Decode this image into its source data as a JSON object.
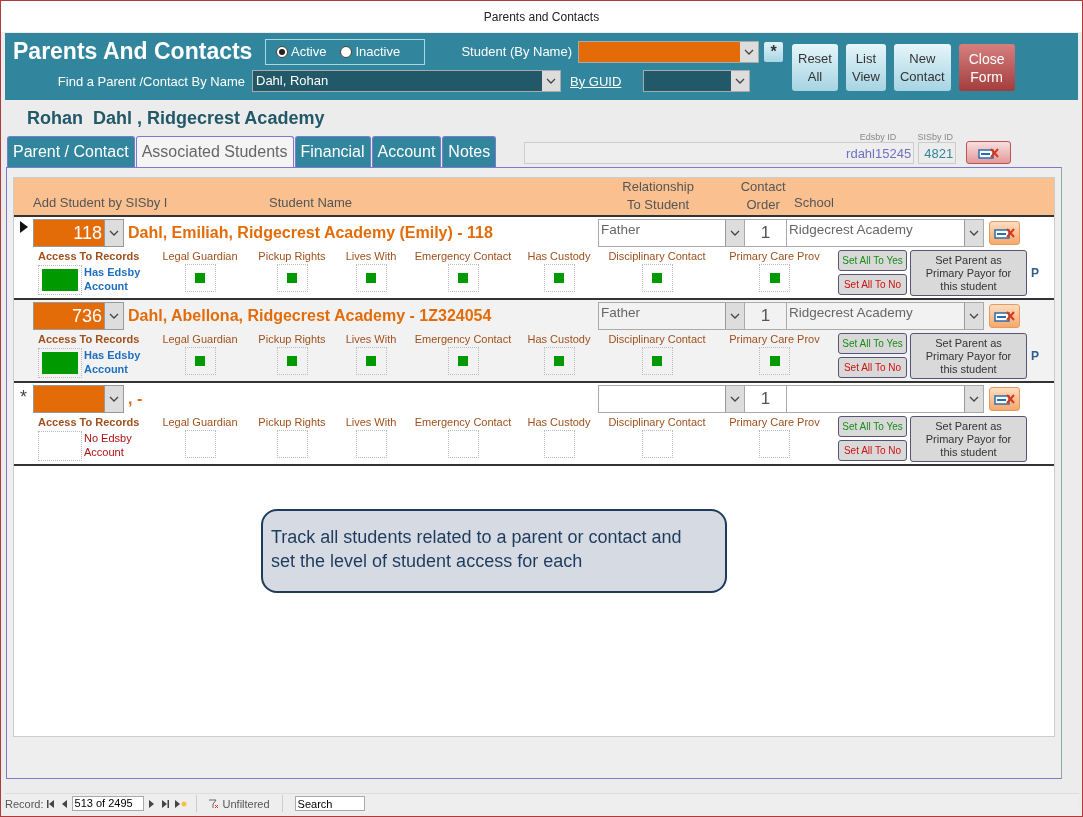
{
  "window": {
    "title": "Parents and Contacts"
  },
  "header": {
    "title": "Parents And Contacts",
    "status_options": [
      {
        "label": "Active",
        "selected": true
      },
      {
        "label": "Inactive",
        "selected": false
      }
    ],
    "student_label": "Student (By Name)",
    "clear_button": "*",
    "find_label": "Find a Parent /Contact By Name",
    "find_value": "Dahl, Rohan",
    "guid_link": "By GUID",
    "buttons": [
      {
        "label": "Reset All",
        "kind": "normal"
      },
      {
        "label": "List View",
        "kind": "normal"
      },
      {
        "label": "New Contact",
        "kind": "normal"
      },
      {
        "label": "Close Form",
        "kind": "danger"
      }
    ]
  },
  "contact_name": "Rohan  Dahl , Ridgecrest Academy",
  "tabs": [
    {
      "label": "Parent / Contact",
      "selected": false
    },
    {
      "label": "Associated Students",
      "selected": true
    },
    {
      "label": "Financial",
      "selected": false
    },
    {
      "label": "Account",
      "selected": false
    },
    {
      "label": "Notes",
      "selected": false
    }
  ],
  "ids": {
    "edsby_label": "Edsby ID",
    "edsby_value": "rdahl15245",
    "sisby_label": "SISby ID",
    "sisby_value": "4821"
  },
  "columns": {
    "add_student": "Add Student by SISby I",
    "student_name": "Student Name",
    "relationship": "Relationship To Student",
    "contact_order": "Contact Order",
    "school": "School"
  },
  "records": [
    {
      "kind": "current",
      "sisby_id": "118",
      "name": "Dahl, Emiliah, Ridgecrest Academy (Emily)  - 118",
      "relationship": "Father",
      "contact_order": "1",
      "school": "Ridgecrest Academy",
      "access_label": "Access To Records",
      "has_account": true,
      "account_text": "Has Edsby Account",
      "flags": [
        {
          "label": "Legal Guardian",
          "checked": true
        },
        {
          "label": "Pickup Rights",
          "checked": true
        },
        {
          "label": "Lives With",
          "checked": true
        },
        {
          "label": "Emergency Contact",
          "checked": true
        },
        {
          "label": "Has Custody",
          "checked": true
        },
        {
          "label": "Disciplinary Contact",
          "checked": true
        },
        {
          "label": "Primary Care Prov",
          "checked": true
        }
      ],
      "set_yes": "Set All To Yes",
      "set_no": "Set All To No",
      "payor_button": "Set Parent as Primary Payor for this student",
      "payor_mark": "P"
    },
    {
      "kind": "saved",
      "sisby_id": "736",
      "name": "Dahl, Abellona, Ridgecrest Academy  - 1Z324054",
      "relationship": "Father",
      "contact_order": "1",
      "school": "Ridgecrest Academy",
      "access_label": "Access To Records",
      "has_account": true,
      "account_text": "Has Edsby Account",
      "flags": [
        {
          "label": "Legal Guardian",
          "checked": true
        },
        {
          "label": "Pickup Rights",
          "checked": true
        },
        {
          "label": "Lives With",
          "checked": true
        },
        {
          "label": "Emergency Contact",
          "checked": true
        },
        {
          "label": "Has Custody",
          "checked": true
        },
        {
          "label": "Disciplinary Contact",
          "checked": true
        },
        {
          "label": "Primary Care Prov",
          "checked": true
        }
      ],
      "set_yes": "Set All To Yes",
      "set_no": "Set All To No",
      "payor_button": "Set Parent as Primary Payor for this student",
      "payor_mark": "P"
    },
    {
      "kind": "new",
      "selector_text": "*",
      "name": ",  -",
      "contact_order": "1",
      "access_label": "Access To Records",
      "has_account": false,
      "account_text": "No Edsby Account",
      "flags": [
        {
          "label": "Legal Guardian",
          "checked": false
        },
        {
          "label": "Pickup Rights",
          "checked": false
        },
        {
          "label": "Lives With",
          "checked": false
        },
        {
          "label": "Emergency Contact",
          "checked": false
        },
        {
          "label": "Has Custody",
          "checked": false
        },
        {
          "label": "Disciplinary Contact",
          "checked": false
        },
        {
          "label": "Primary Care Prov",
          "checked": false
        }
      ],
      "set_yes": "Set All To Yes",
      "set_no": "Set All To No",
      "payor_button": "Set Parent as Primary Payor for this student"
    }
  ],
  "callout": "Track all students related to a parent or contact and set the level of student access for each",
  "status_bar": {
    "record_label": "Record:",
    "position": "513 of 2495",
    "filter": "Unfiltered",
    "search_placeholder": "Search"
  }
}
